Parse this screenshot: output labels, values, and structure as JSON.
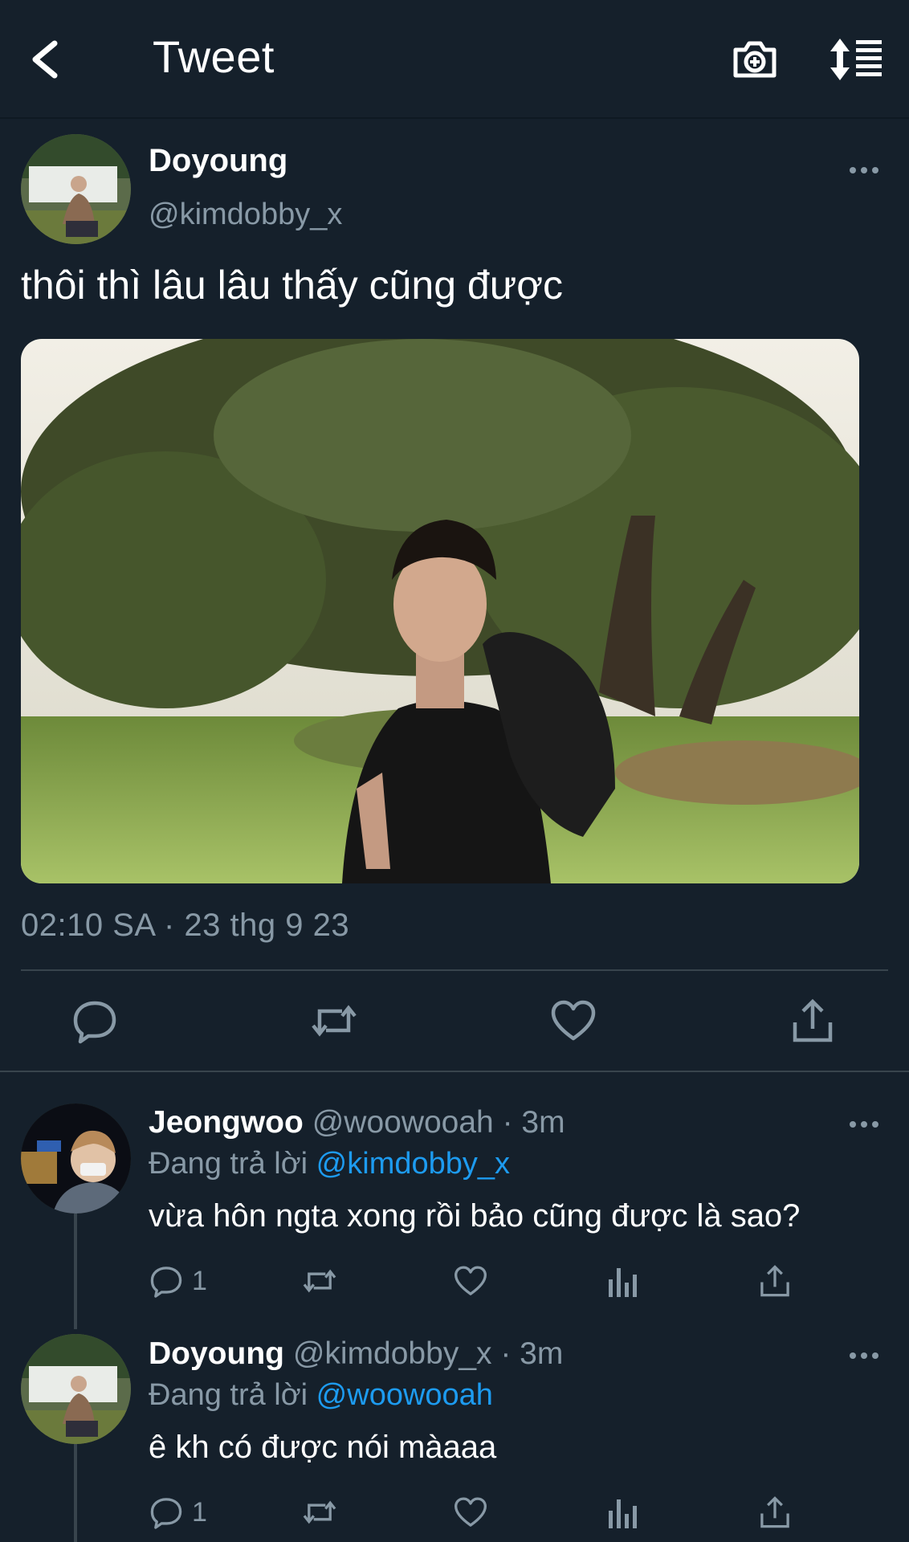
{
  "header": {
    "title": "Tweet",
    "back_icon": "chevron-left-icon",
    "camera_icon": "camera-add-icon",
    "sort_icon": "sort-icon"
  },
  "tweet": {
    "author": {
      "name": "Doyoung",
      "handle": "@kimdobby_x"
    },
    "text": "thôi thì lâu lâu thấy cũng được",
    "timestamp": "02:10 SA · 23 thg 9 23",
    "actions": [
      "reply-icon",
      "retweet-icon",
      "like-icon",
      "share-icon"
    ]
  },
  "replies": [
    {
      "name": "Jeongwoo",
      "handle": "@woowooah",
      "time": "· 3m",
      "replying_label": "Đang trả lời",
      "replying_to": "@kimdobby_x",
      "text": "vừa hôn ngta xong rồi bảo cũng được là sao?",
      "reply_count": "1"
    },
    {
      "name": "Doyoung",
      "handle": "@kimdobby_x",
      "time": "· 3m",
      "replying_label": "Đang trả lời",
      "replying_to": "@woowooah",
      "text": "ê kh có được nói màaaa",
      "reply_count": "1"
    }
  ],
  "colors": {
    "background": "#15202b",
    "secondary_text": "#8899a6",
    "link": "#1d9bf0",
    "divider": "#38444d"
  }
}
